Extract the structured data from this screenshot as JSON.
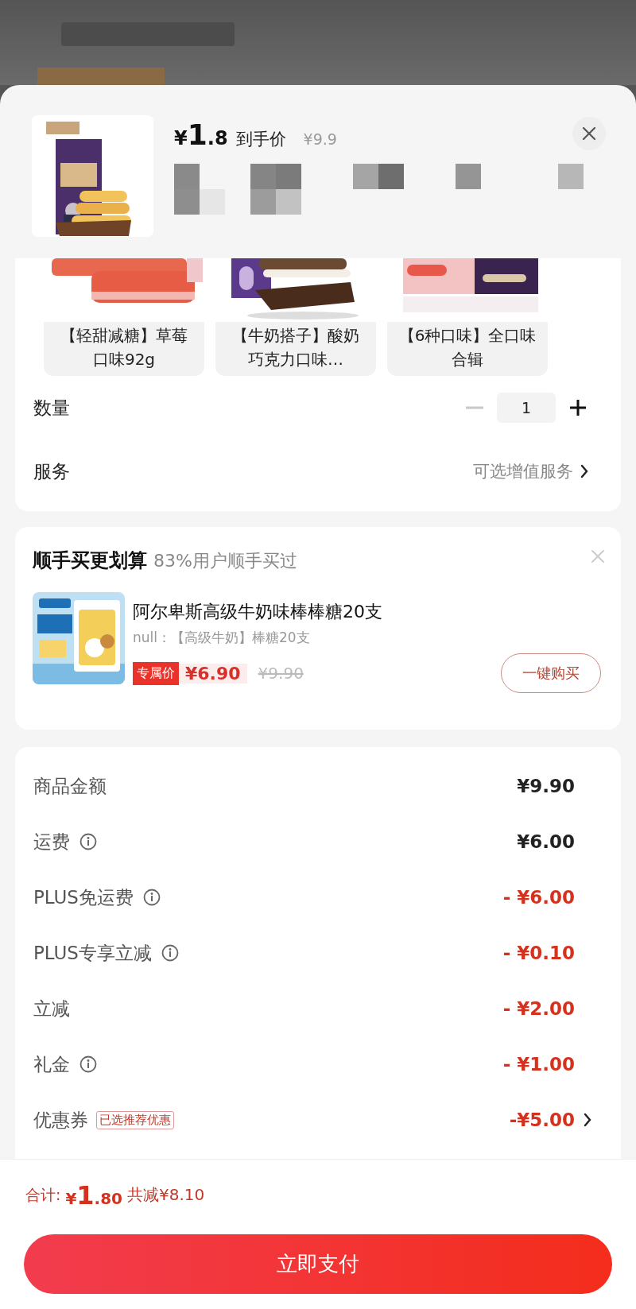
{
  "header": {
    "price_symbol": "¥",
    "price_int": "1",
    "price_dec": ".8",
    "price_label": "到手价",
    "original_price": "¥9.9"
  },
  "variants": [
    {
      "label": "【轻甜减糖】草莓口味92g",
      "kind": "strawberry"
    },
    {
      "label": "【牛奶搭子】酸奶巧克力口味…",
      "kind": "chocolate"
    },
    {
      "label": "【6种口味】全口味合辑",
      "kind": "assorted"
    }
  ],
  "quantity": {
    "label": "数量",
    "value": "1",
    "decrease_disabled": true
  },
  "service": {
    "label": "服务",
    "value": "可选增值服务"
  },
  "addon": {
    "title": "顺手买更划算",
    "subtitle": "83%用户顺手买过",
    "name": "阿尔卑斯高级牛奶味棒棒糖20支",
    "spec": "null：【高级牛奶】棒糖20支",
    "tag": "专属价",
    "price": "¥6.90",
    "original_price": "¥9.90",
    "button": "一键购买"
  },
  "fees": [
    {
      "label": "商品金额",
      "amount": "¥9.90",
      "info": false,
      "discount": false
    },
    {
      "label": "运费",
      "amount": "¥6.00",
      "info": true,
      "discount": false
    },
    {
      "label": "PLUS免运费",
      "amount": "- ¥6.00",
      "info": true,
      "discount": true
    },
    {
      "label": "PLUS专享立减",
      "amount": "- ¥0.10",
      "info": true,
      "discount": true
    },
    {
      "label": "立减",
      "amount": "- ¥2.00",
      "info": false,
      "discount": true
    },
    {
      "label": "礼金",
      "amount": "- ¥1.00",
      "info": true,
      "discount": true
    },
    {
      "label": "优惠券",
      "badge": "已选推荐优惠",
      "amount": "-¥5.00",
      "info": false,
      "discount": true,
      "chevron": true
    }
  ],
  "footer": {
    "total_label": "合计:",
    "total_symbol": "¥",
    "total_int": "1",
    "total_dec": ".80",
    "saved": "共减¥8.10",
    "pay_button": "立即支付"
  }
}
